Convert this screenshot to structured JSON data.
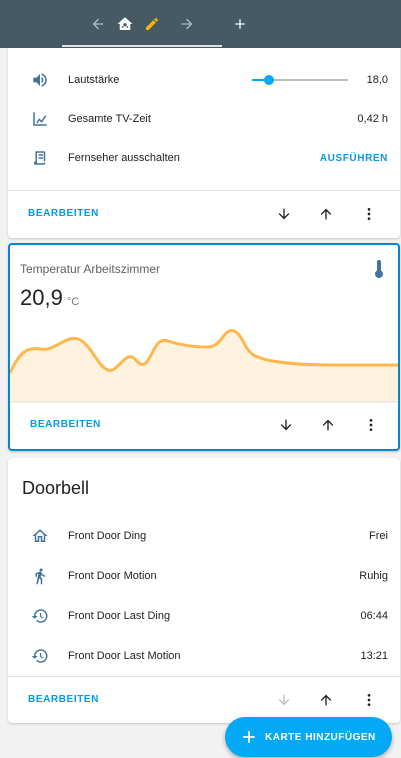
{
  "toolbar": {
    "back_icon": "arrow-left-icon",
    "view_icon": "home-assistant-icon",
    "edit_icon": "pencil-icon",
    "forward_icon": "arrow-right-icon",
    "add_icon": "plus-icon"
  },
  "tv_card": {
    "rows": [
      {
        "icon": "volume-icon",
        "label": "Lautstärke",
        "value": "18,0",
        "slider_fraction": 0.18
      },
      {
        "icon": "chart-line-icon",
        "label": "Gesamte TV-Zeit",
        "value": "0,42 h"
      },
      {
        "icon": "script-icon",
        "label": "Fernseher ausschalten",
        "action": "AUSFÜHREN"
      }
    ],
    "edit_label": "BEARBEITEN"
  },
  "sensor_card": {
    "name": "Temperatur Arbeitszimmer",
    "value": "20,9",
    "unit": "°C",
    "icon": "thermometer-icon",
    "edit_label": "BEARBEITEN",
    "colors": {
      "line": "#ffb74d",
      "fill": "#fff3e0",
      "border": "#0288d1"
    }
  },
  "doorbell_card": {
    "title": "Doorbell",
    "rows": [
      {
        "icon": "home-outline-icon",
        "label": "Front Door Ding",
        "value": "Frei"
      },
      {
        "icon": "walk-icon",
        "label": "Front Door Motion",
        "value": "Ruhig"
      },
      {
        "icon": "history-icon",
        "label": "Front Door Last Ding",
        "value": "06:44"
      },
      {
        "icon": "history-icon",
        "label": "Front Door Last Motion",
        "value": "13:21"
      }
    ],
    "edit_label": "BEARBEITEN"
  },
  "fab": {
    "label": "KARTE HINZUFÜGEN",
    "icon": "plus-icon"
  },
  "colors": {
    "accent": "#03a9f4",
    "toolbar": "#455a64",
    "icon": "#44739e"
  }
}
